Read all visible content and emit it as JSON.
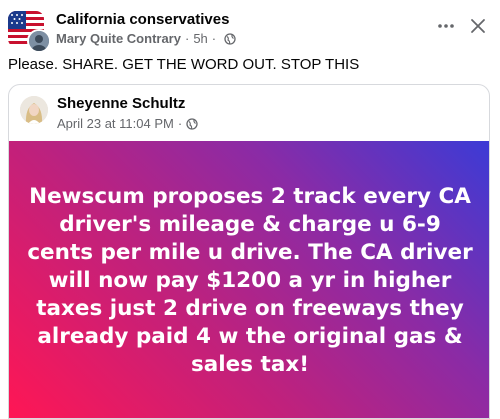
{
  "post": {
    "group_name": "California conservatives",
    "author": "Mary Quite Contrary",
    "time": "5h",
    "text": "Please. SHARE. GET THE WORD OUT. STOP THIS"
  },
  "shared_post": {
    "author": "Sheyenne Schultz",
    "date": "April 23 at 11:04 PM",
    "text": "Newscum proposes 2 track every CA driver's mileage & charge u 6-9 cents per mile u drive. The CA driver will now pay $1200 a yr in higher taxes just 2 drive on freeways they already paid 4 w the original gas & sales tax!"
  },
  "icons": {
    "more": "more-horizontal-icon",
    "close": "close-icon",
    "privacy": "globe-icon"
  },
  "colors": {
    "gradient_start": "#ff1654",
    "gradient_end": "#3b3bd6",
    "secondary_text": "#65676b"
  }
}
